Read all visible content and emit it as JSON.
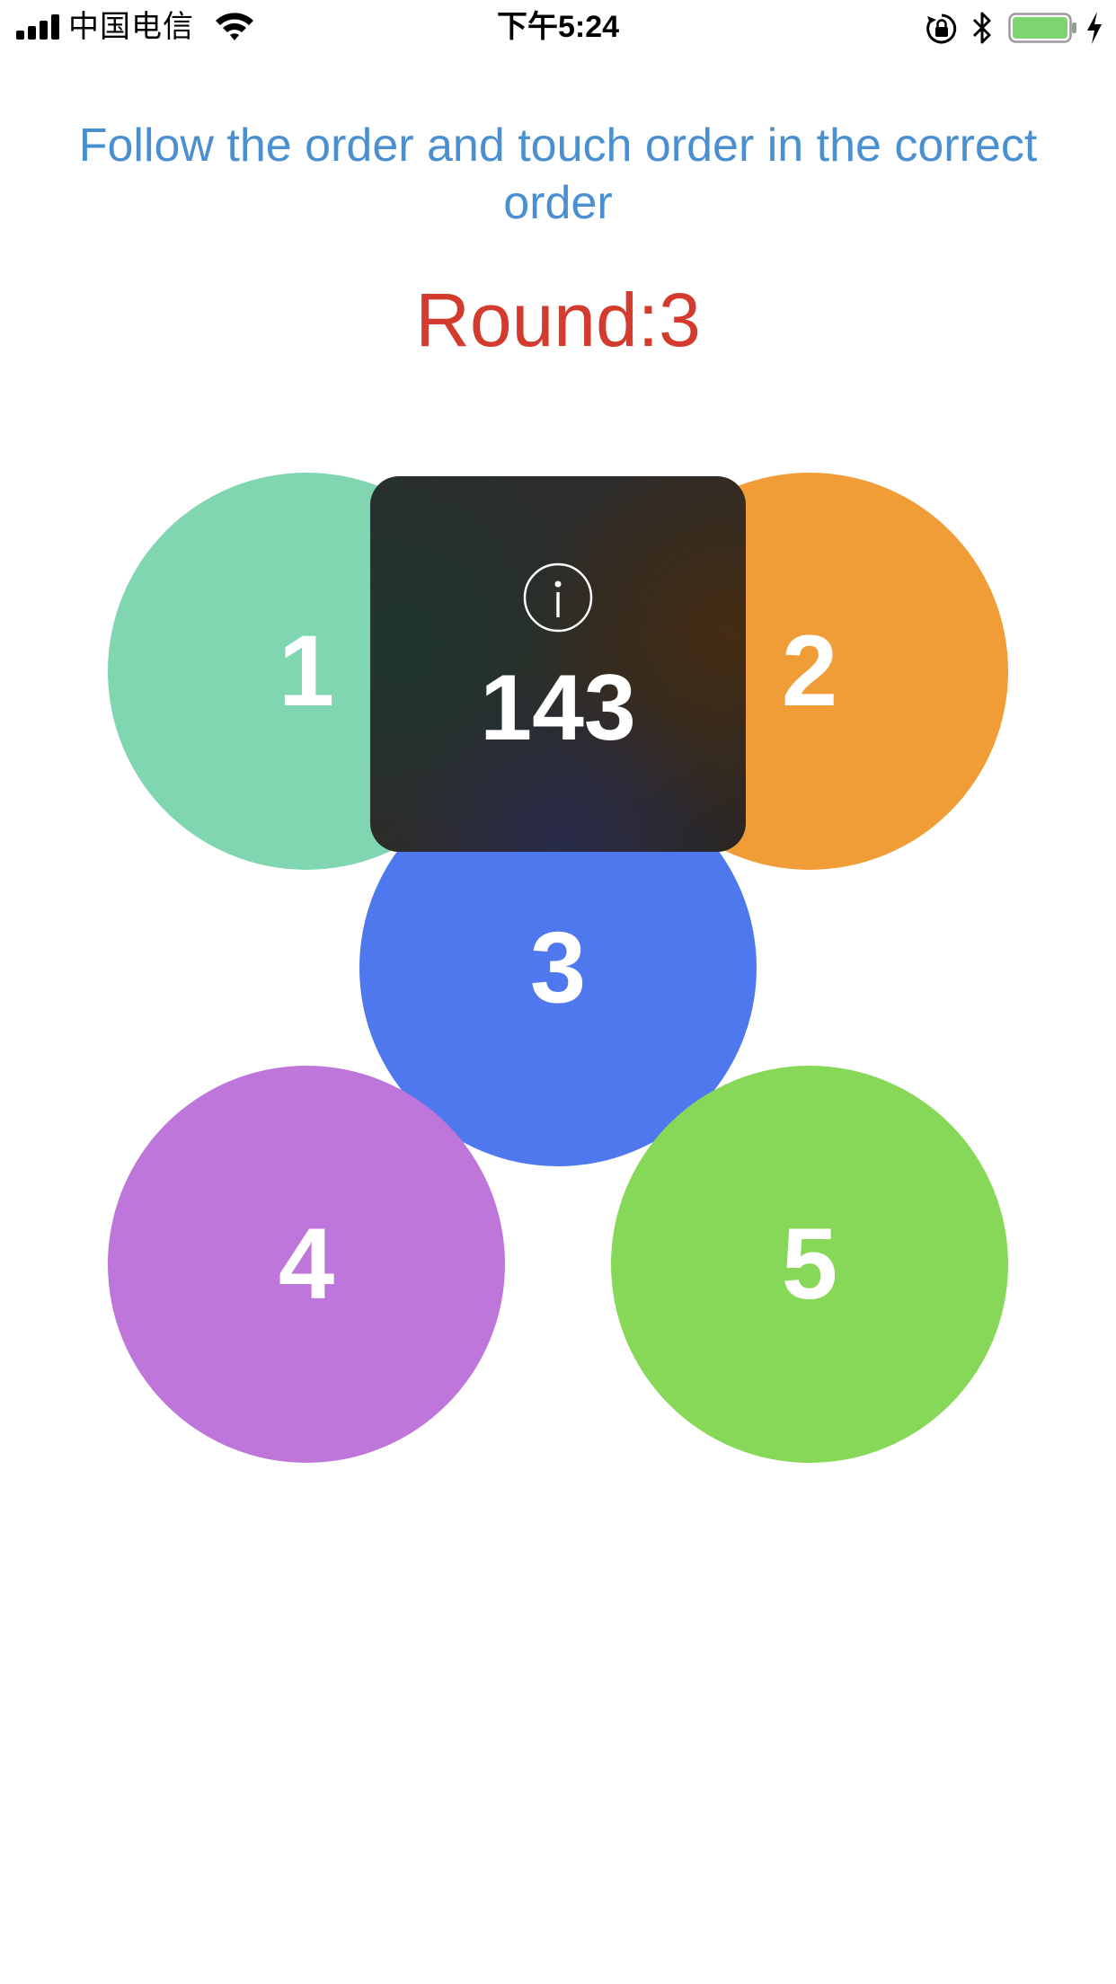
{
  "status_bar": {
    "carrier": "中国电信",
    "time": "下午5:24",
    "icons": [
      "signal-icon",
      "wifi-icon",
      "rotation-lock-icon",
      "bluetooth-icon",
      "battery-icon",
      "charging-icon"
    ],
    "battery_level": 1.0,
    "battery_color": "#7ed56f"
  },
  "game": {
    "instruction": "Follow the order and touch order in the correct order",
    "instruction_color": "#4a90d0",
    "round_label": "Round:3",
    "round_color": "#d23b2e",
    "circles": [
      {
        "label": "1",
        "color": "#80d6b0"
      },
      {
        "label": "2",
        "color": "#f09c37"
      },
      {
        "label": "3",
        "color": "#4f78ee"
      },
      {
        "label": "4",
        "color": "#bf76db"
      },
      {
        "label": "5",
        "color": "#87d858"
      }
    ]
  },
  "hud": {
    "icon": "info-icon",
    "value": "143"
  }
}
